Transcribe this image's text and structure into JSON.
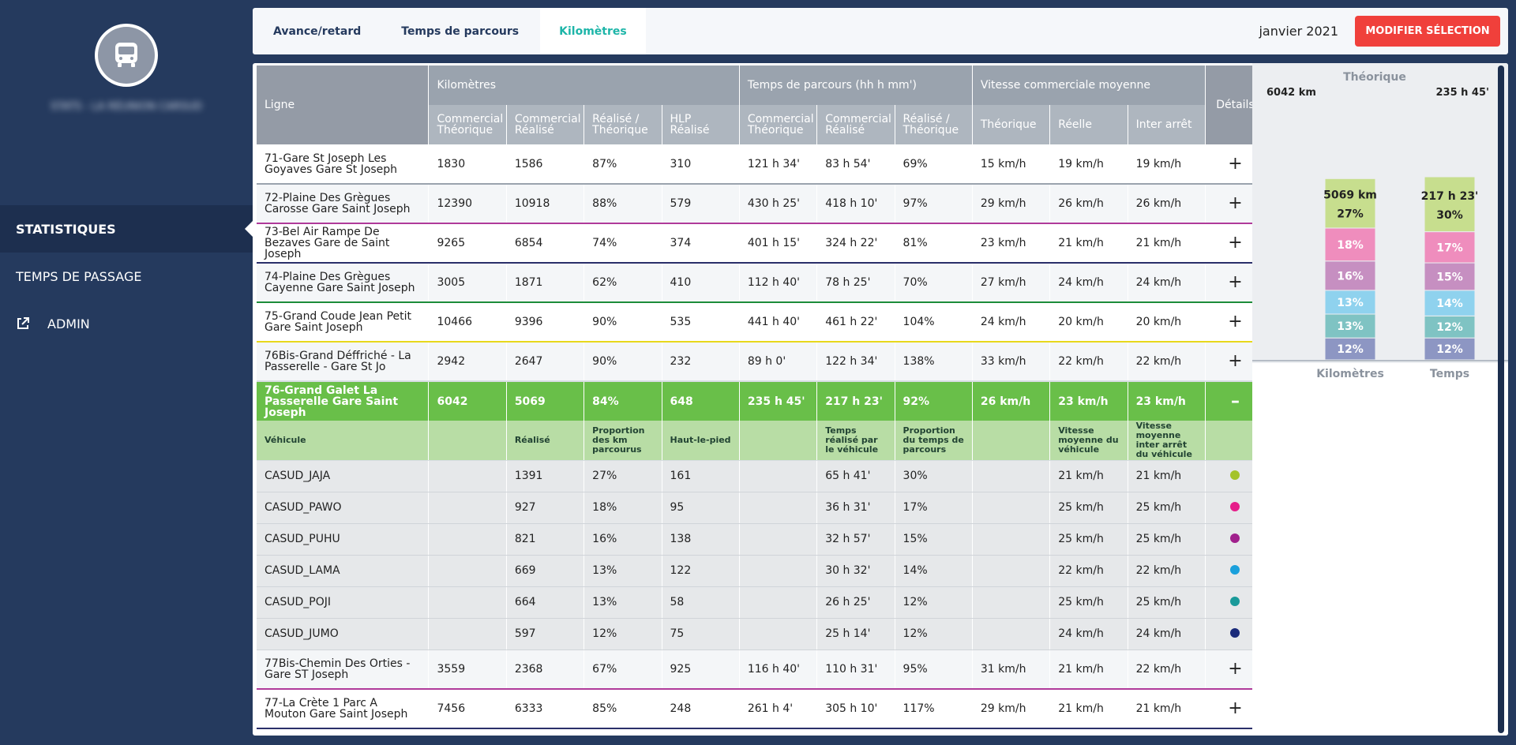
{
  "sidebar": {
    "user_name": "STATS - LA RÉUNION CARSUD",
    "items": [
      {
        "label": "STATISTIQUES"
      },
      {
        "label": "TEMPS DE PASSAGE"
      },
      {
        "label": "ADMIN"
      }
    ]
  },
  "topbar": {
    "tabs": [
      {
        "label": "Avance/retard"
      },
      {
        "label": "Temps de parcours"
      },
      {
        "label": "Kilomètres"
      }
    ],
    "active_tab": "Kilomètres",
    "date": "janvier 2021",
    "modify_button": "MODIFIER SÉLECTION"
  },
  "table": {
    "group_headers": {
      "ligne": "Ligne",
      "km": "Kilomètres",
      "time": "Temps de parcours (hh h mm')",
      "speed": "Vitesse commerciale moyenne",
      "details": "Détails"
    },
    "sub_headers": [
      "Commercial Théorique",
      "Commercial Réalisé",
      "Réalisé / Théorique",
      "HLP Réalisé",
      "Commercial Théorique",
      "Commercial Réalisé",
      "Réalisé / Théorique",
      "Théorique",
      "Réelle",
      "Inter arrêt"
    ],
    "rows_before": [
      {
        "ligne": "71-Gare St Joseph Les Goyaves Gare St Joseph",
        "v": [
          "1830",
          "1586",
          "87%",
          "310",
          "121 h 34'",
          "83 h 54'",
          "69%",
          "15 km/h",
          "19 km/h",
          "19 km/h"
        ],
        "det": "+",
        "color": "#9aa3ae"
      },
      {
        "ligne": "72-Plaine Des Grègues Carosse Gare Saint Joseph",
        "v": [
          "12390",
          "10918",
          "88%",
          "579",
          "430 h 25'",
          "418 h 10'",
          "97%",
          "29 km/h",
          "26 km/h",
          "26 km/h"
        ],
        "det": "+",
        "color": "#b03a9a"
      },
      {
        "ligne": "73-Bel Air Rampe De Bezaves Gare de Saint Joseph",
        "v": [
          "9265",
          "6854",
          "74%",
          "374",
          "401 h 15'",
          "324 h 22'",
          "81%",
          "23 km/h",
          "21 km/h",
          "21 km/h"
        ],
        "det": "+",
        "color": "#2a2f6a"
      },
      {
        "ligne": "74-Plaine Des Grègues Cayenne Gare Saint Joseph",
        "v": [
          "3005",
          "1871",
          "62%",
          "410",
          "112 h 40'",
          "78 h 25'",
          "70%",
          "27 km/h",
          "24 km/h",
          "24 km/h"
        ],
        "det": "+",
        "color": "#1d8c3a"
      },
      {
        "ligne": "75-Grand Coude Jean Petit Gare Saint Joseph",
        "v": [
          "10466",
          "9396",
          "90%",
          "535",
          "441 h 40'",
          "461 h 22'",
          "104%",
          "24 km/h",
          "20 km/h",
          "20 km/h"
        ],
        "det": "+",
        "color": "#e8d81c"
      },
      {
        "ligne": "76Bis-Grand Déffriché - La Passerelle - Gare St Jo",
        "v": [
          "2942",
          "2647",
          "90%",
          "232",
          "89 h 0'",
          "122 h 34'",
          "138%",
          "33 km/h",
          "22 km/h",
          "22 km/h"
        ],
        "det": "+",
        "color": "#d8dde3"
      }
    ],
    "selected_row": {
      "ligne": "76-Grand Galet La Passerelle Gare Saint Joseph",
      "v": [
        "6042",
        "5069",
        "84%",
        "648",
        "235 h 45'",
        "217 h 23'",
        "92%",
        "26 km/h",
        "23 km/h",
        "23 km/h"
      ],
      "det": "–"
    },
    "vehicle_headers": [
      "Véhicule",
      "",
      "Réalisé",
      "Proportion des km parcourus",
      "Haut-le-pied",
      "",
      "Temps réalisé par le véhicule",
      "Proportion du temps de parcours",
      "",
      "Vitesse moyenne du véhicule",
      "Vitesse moyenne inter arrêt du véhicule",
      ""
    ],
    "vehicles": [
      {
        "name": "CASUD_JAJA",
        "v": [
          "",
          "1391",
          "27%",
          "161",
          "",
          "65 h 41'",
          "30%",
          "",
          "21 km/h",
          "21 km/h"
        ],
        "dot": "#a4c32a"
      },
      {
        "name": "CASUD_PAWO",
        "v": [
          "",
          "927",
          "18%",
          "95",
          "",
          "36 h 31'",
          "17%",
          "",
          "25 km/h",
          "25 km/h"
        ],
        "dot": "#e61e8a"
      },
      {
        "name": "CASUD_PUHU",
        "v": [
          "",
          "821",
          "16%",
          "138",
          "",
          "32 h 57'",
          "15%",
          "",
          "25 km/h",
          "25 km/h"
        ],
        "dot": "#a0208c"
      },
      {
        "name": "CASUD_LAMA",
        "v": [
          "",
          "669",
          "13%",
          "122",
          "",
          "30 h 32'",
          "14%",
          "",
          "22 km/h",
          "22 km/h"
        ],
        "dot": "#1aa0dc"
      },
      {
        "name": "CASUD_POJI",
        "v": [
          "",
          "664",
          "13%",
          "58",
          "",
          "26 h 25'",
          "12%",
          "",
          "25 km/h",
          "25 km/h"
        ],
        "dot": "#1a9a9a"
      },
      {
        "name": "CASUD_JUMO",
        "v": [
          "",
          "597",
          "12%",
          "75",
          "",
          "25 h 14'",
          "12%",
          "",
          "24 km/h",
          "24 km/h"
        ],
        "dot": "#1a2a7a"
      }
    ],
    "rows_after": [
      {
        "ligne": "77Bis-Chemin Des Orties - Gare ST Joseph",
        "v": [
          "3559",
          "2368",
          "67%",
          "925",
          "116 h 40'",
          "110 h 31'",
          "95%",
          "31 km/h",
          "21 km/h",
          "22 km/h"
        ],
        "det": "+",
        "color": "#b03a9a"
      },
      {
        "ligne": "77-La Crète 1 Parc A Mouton Gare Saint Joseph",
        "v": [
          "7456",
          "6333",
          "85%",
          "248",
          "261 h 4'",
          "305 h 10'",
          "117%",
          "29 km/h",
          "21 km/h",
          "21 km/h"
        ],
        "det": "+",
        "color": "#2a2f6a"
      }
    ]
  },
  "chart_data": {
    "type": "bar",
    "title": "Théorique",
    "theoretical": {
      "km": "6042 km",
      "time": "235 h 45'"
    },
    "categories": [
      "Kilomètres",
      "Temps"
    ],
    "top_labels": [
      "5069 km",
      "217 h 23'"
    ],
    "series": [
      {
        "color": "#8d96c3",
        "values": [
          12,
          12
        ]
      },
      {
        "color": "#7fc3c3",
        "values": [
          13,
          12
        ]
      },
      {
        "color": "#8fd2ee",
        "values": [
          13,
          14
        ]
      },
      {
        "color": "#c68fc1",
        "values": [
          16,
          15
        ]
      },
      {
        "color": "#ef8dbd",
        "values": [
          18,
          17
        ]
      },
      {
        "color": "#c7de8e",
        "values": [
          27,
          30
        ]
      }
    ]
  }
}
